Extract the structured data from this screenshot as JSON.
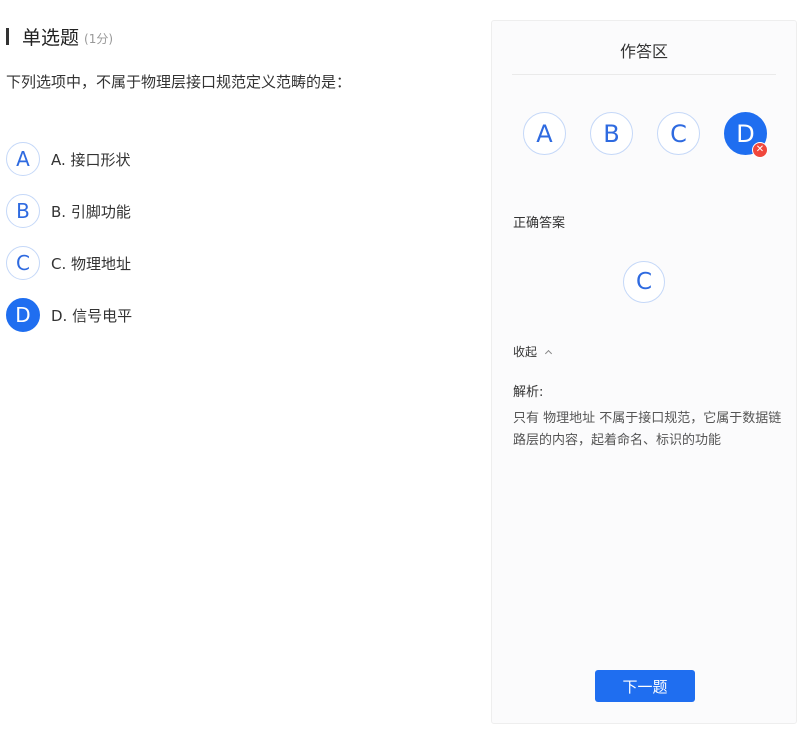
{
  "question": {
    "type_label": "单选题",
    "score": "(1分)",
    "stem": "下列选项中，不属于物理层接口规范定义范畴的是："
  },
  "options": [
    {
      "letter": "A",
      "text": "A. 接口形状",
      "selected": false
    },
    {
      "letter": "B",
      "text": "B. 引脚功能",
      "selected": false
    },
    {
      "letter": "C",
      "text": "C. 物理地址",
      "selected": false
    },
    {
      "letter": "D",
      "text": "D. 信号电平",
      "selected": true
    }
  ],
  "answer_panel": {
    "title": "作答区",
    "choices": [
      "A",
      "B",
      "C",
      "D"
    ],
    "selected_choice": "D",
    "wrong_mark": "✕",
    "correct_label": "正确答案",
    "correct_answer": "C",
    "collapse_label": "收起",
    "analysis_label": "解析:",
    "analysis_text": "只有 物理地址 不属于接口规范，它属于数据链路层的内容，起着命名、标识的功能",
    "next_button": "下一题"
  },
  "colors": {
    "primary": "#1f6ef0",
    "error": "#f0473c",
    "circle_border": "#c5d8f8"
  }
}
